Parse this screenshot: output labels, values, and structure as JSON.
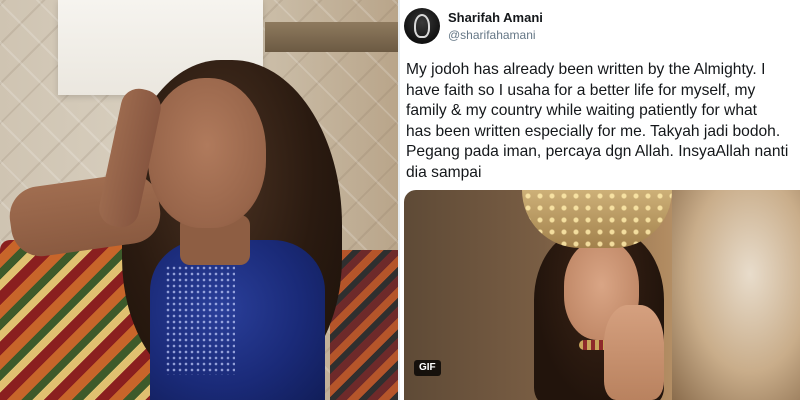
{
  "tweet": {
    "display_name": "Sharifah Amani",
    "handle": "@sharifahamani",
    "text_lines": [
      "My jodoh has already been written by the Almighty. I",
      "have faith so I usaha for a better life for myself, my",
      "family & my country while waiting patiently for what",
      "has been written especially for me. Takyah jadi bodoh.",
      "Pegang pada iman, percaya dgn Allah. InsyaAllah nanti",
      "dia sampai"
    ],
    "media_badge": "GIF"
  },
  "colors": {
    "text_primary": "#14171a",
    "text_secondary": "#657786",
    "divider": "#e6ecf0"
  }
}
